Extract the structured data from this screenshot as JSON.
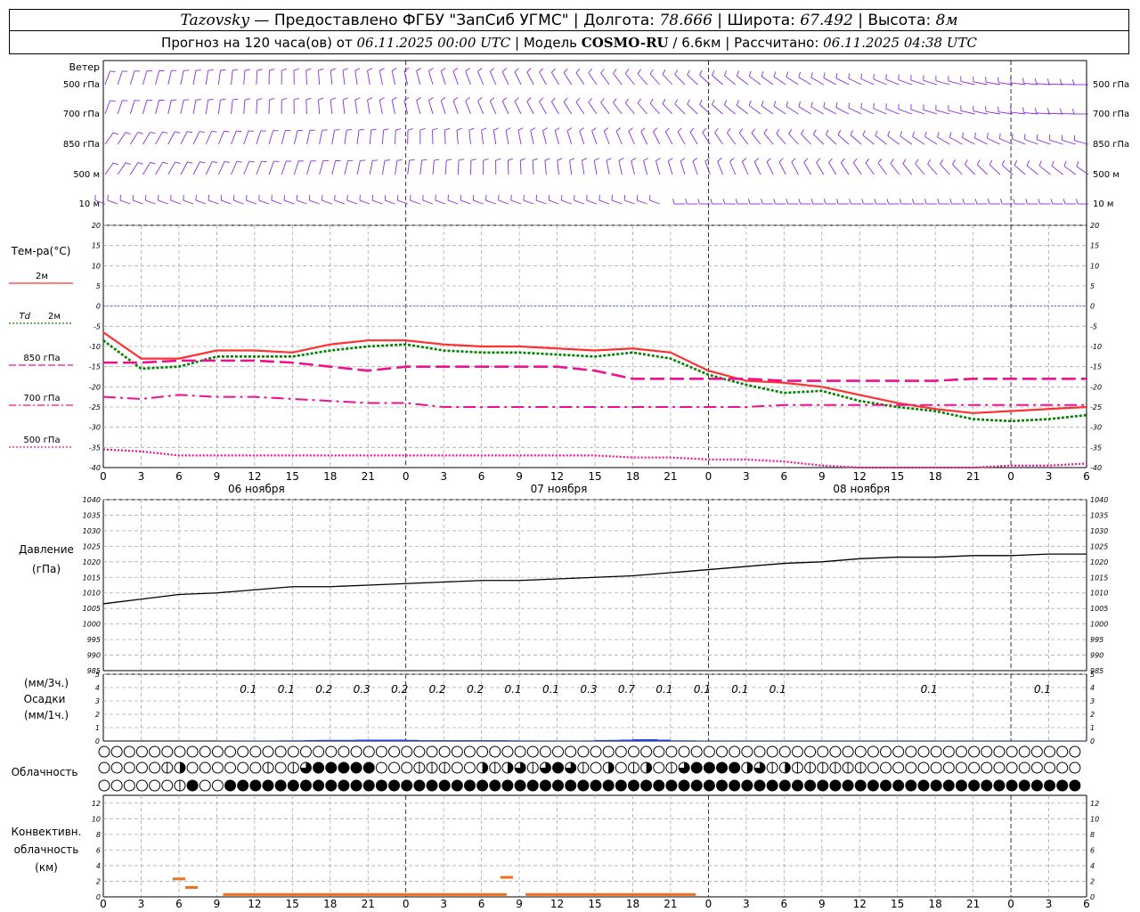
{
  "header": {
    "station": "Tazovsky",
    "provided_by": "— Предоставлено ФГБУ \"ЗапСиб УГМС\"",
    "lon_label": "Долгота:",
    "lon_value": "78.666",
    "lat_label": "Широта:",
    "lat_value": "67.492",
    "alt_label": "Высота:",
    "alt_value": "8м",
    "forecast_label": "Прогноз на 120 часа(ов) от",
    "forecast_start": "06.11.2025 00:00 UTC",
    "model_label": "Модель",
    "model_name": "COSMO-RU",
    "model_res": "/ 6.6км",
    "computed_label": "Рассчитано:",
    "computed_time": "06.11.2025 04:38 UTC"
  },
  "wind_panel": {
    "title": "Ветер",
    "levels": [
      "500 гПа",
      "700 гПа",
      "850 гПа",
      "500 м",
      "10 м"
    ],
    "color": "#8a2be2"
  },
  "time_axis": {
    "hour_ticks": [
      "0",
      "3",
      "6",
      "9",
      "12",
      "15",
      "18",
      "21",
      "0",
      "3",
      "6",
      "9",
      "12",
      "15",
      "18",
      "21",
      "0",
      "3",
      "6",
      "9",
      "12",
      "15",
      "18",
      "21",
      "0",
      "3",
      "6"
    ],
    "dates": [
      "06 ноября",
      "07 ноября",
      "08 ноября"
    ]
  },
  "chart_data": [
    {
      "type": "line",
      "name": "temperature",
      "title": "Тем-ра(°C)",
      "ylim": [
        -40,
        20
      ],
      "yticks": [
        "20",
        "15",
        "10",
        "5",
        "0",
        "-5",
        "-10",
        "-15",
        "-20",
        "-25",
        "-30",
        "-35",
        "-40"
      ],
      "x_hours": [
        0,
        3,
        6,
        9,
        12,
        15,
        18,
        21,
        24,
        27,
        30,
        33,
        36,
        39,
        42,
        45,
        48,
        51,
        54,
        57,
        60,
        63,
        66,
        69,
        72,
        75,
        78
      ],
      "series": [
        {
          "name": "2м",
          "color": "#ff3030",
          "values": [
            -6.5,
            -13,
            -13,
            -11,
            -11,
            -11.5,
            -9.5,
            -8.5,
            -8.5,
            -9.5,
            -10,
            -10,
            -10.5,
            -11,
            -10.5,
            -11.5,
            -16,
            -18.5,
            -19,
            -20,
            -22,
            -24,
            -25.5,
            -26.5,
            -26,
            -25.5,
            -25
          ]
        },
        {
          "name": "Td 2м",
          "color": "#008000",
          "values": [
            -8.5,
            -15.5,
            -15,
            -12.5,
            -12.5,
            -12.5,
            -11,
            -10,
            -9.5,
            -11,
            -11.5,
            -11.5,
            -12,
            -12.5,
            -11.5,
            -13,
            -17,
            -19.5,
            -21.5,
            -21,
            -23.5,
            -25,
            -26,
            -28,
            -28.5,
            -28,
            -27
          ]
        },
        {
          "name": "850 гПа",
          "color": "#ee1090",
          "values": [
            -14,
            -14,
            -13.5,
            -13.5,
            -13.5,
            -14,
            -15,
            -16,
            -15,
            -15,
            -15,
            -15,
            -15,
            -16,
            -18,
            -18,
            -18,
            -18,
            -18.5,
            -18.5,
            -18.5,
            -18.5,
            -18.5,
            -18,
            -18,
            -18,
            -18
          ]
        },
        {
          "name": "700 гПа",
          "color": "#ee1090",
          "values": [
            -22.5,
            -23,
            -22,
            -22.5,
            -22.5,
            -23,
            -23.5,
            -24,
            -24,
            -25,
            -25,
            -25,
            -25,
            -25,
            -25,
            -25,
            -25,
            -25,
            -24.5,
            -24.5,
            -24.5,
            -24.5,
            -24.5,
            -24.5,
            -24.5,
            -24.5,
            -24.5
          ]
        },
        {
          "name": "500 гПа",
          "color": "#ee1090",
          "values": [
            -35.5,
            -36,
            -37,
            -37,
            -37,
            -37,
            -37,
            -37,
            -37,
            -37,
            -37,
            -37,
            -37,
            -37,
            -37.5,
            -37.5,
            -38,
            -38,
            -38.5,
            -39.5,
            -40,
            -40,
            -40,
            -40,
            -39.5,
            -39.5,
            -39
          ]
        }
      ]
    },
    {
      "type": "line",
      "name": "pressure",
      "title": "Давление",
      "ylabel": "(гПа)",
      "ylim": [
        985,
        1040
      ],
      "yticks": [
        "1040",
        "1035",
        "1030",
        "1025",
        "1020",
        "1015",
        "1010",
        "1005",
        "1000",
        "995",
        "990",
        "985"
      ],
      "x_hours": [
        0,
        3,
        6,
        9,
        12,
        15,
        18,
        21,
        24,
        27,
        30,
        33,
        36,
        39,
        42,
        45,
        48,
        51,
        54,
        57,
        60,
        63,
        66,
        69,
        72,
        75,
        78
      ],
      "values": [
        1006.5,
        1008,
        1009.5,
        1010,
        1011,
        1012,
        1012,
        1012.5,
        1013,
        1013.5,
        1014,
        1014,
        1014.5,
        1015,
        1015.5,
        1016.5,
        1017.5,
        1018.5,
        1019.5,
        1020,
        1021,
        1021.5,
        1021.5,
        1022,
        1022,
        1022.5,
        1022.5
      ]
    },
    {
      "type": "bar",
      "name": "precipitation",
      "title": "Осадки",
      "ylabel_top": "(мм/3ч.)",
      "ylabel_bottom": "(мм/1ч.)",
      "ylim": [
        0,
        5
      ],
      "yticks": [
        "5",
        "4",
        "3",
        "2",
        "1",
        "0"
      ],
      "labels": [
        {
          "hour": 12,
          "text": "0.1"
        },
        {
          "hour": 15,
          "text": "0.1"
        },
        {
          "hour": 18,
          "text": "0.2"
        },
        {
          "hour": 21,
          "text": "0.3"
        },
        {
          "hour": 24,
          "text": "0.2"
        },
        {
          "hour": 27,
          "text": "0.2"
        },
        {
          "hour": 30,
          "text": "0.2"
        },
        {
          "hour": 33,
          "text": "0.1"
        },
        {
          "hour": 36,
          "text": "0.1"
        },
        {
          "hour": 39,
          "text": "0.3"
        },
        {
          "hour": 42,
          "text": "0.7"
        },
        {
          "hour": 45,
          "text": "0.1"
        },
        {
          "hour": 48,
          "text": "0.1"
        },
        {
          "hour": 51,
          "text": "0.1"
        },
        {
          "hour": 54,
          "text": "0.1"
        },
        {
          "hour": 66,
          "text": "0.1"
        },
        {
          "hour": 75,
          "text": "0.1"
        }
      ],
      "hourly_values": [
        0,
        0,
        0,
        0,
        0,
        0,
        0,
        0,
        0,
        0.02,
        0.02,
        0.03,
        0.03,
        0.03,
        0.05,
        0.05,
        0.07,
        0.08,
        0.08,
        0.08,
        0.1,
        0.1,
        0.1,
        0.1,
        0.08,
        0.06,
        0.06,
        0.06,
        0.06,
        0.06,
        0.06,
        0.06,
        0.05,
        0.04,
        0.02,
        0.02,
        0.02,
        0.03,
        0.04,
        0.07,
        0.08,
        0.1,
        0.13,
        0.13,
        0.1,
        0.05,
        0.05,
        0.03,
        0.02,
        0.02,
        0.02,
        0.02,
        0.02,
        0.02,
        0.02,
        0.02,
        0.02,
        0.02,
        0.02,
        0.02,
        0.02,
        0.02,
        0.02,
        0.02,
        0.02,
        0.02,
        0.03,
        0.02,
        0.02,
        0.02,
        0.02,
        0.02,
        0.02,
        0.02,
        0.03,
        0.02,
        0.02,
        0.02
      ],
      "color": "#2040e0"
    },
    {
      "type": "table",
      "name": "cloudiness",
      "title": "Облачность",
      "note": "Cloud cover symbols in oktas for three layers (top: high, middle: medium, bottom: low), one per hour",
      "high": [
        0,
        0,
        0,
        0,
        0,
        0,
        0,
        0,
        0,
        0,
        0,
        0,
        0,
        0,
        0,
        0,
        0,
        0,
        0,
        0,
        0,
        0,
        0,
        0,
        0,
        0,
        0,
        0,
        0,
        0,
        0,
        0,
        0,
        0,
        0,
        0,
        0,
        0,
        0,
        0,
        0,
        0,
        0,
        0,
        0,
        0,
        0,
        0,
        0,
        0,
        0,
        0,
        0,
        0,
        0,
        0,
        0,
        0,
        0,
        0,
        0,
        0,
        0,
        0,
        0,
        0,
        0,
        0,
        0,
        0,
        0,
        0,
        0,
        0,
        0,
        0,
        0,
        0
      ],
      "middle": [
        0,
        0,
        0,
        0,
        0,
        2,
        4,
        0,
        0,
        0,
        0,
        0,
        0,
        2,
        0,
        2,
        6,
        8,
        8,
        8,
        8,
        8,
        0,
        0,
        0,
        2,
        2,
        2,
        0,
        0,
        4,
        2,
        4,
        6,
        2,
        6,
        8,
        6,
        2,
        0,
        4,
        0,
        2,
        4,
        0,
        2,
        6,
        8,
        8,
        8,
        8,
        4,
        6,
        2,
        4,
        2,
        2,
        2,
        2,
        2,
        2,
        0,
        0,
        0,
        0,
        0,
        0,
        0,
        0,
        0,
        0,
        0,
        0,
        0,
        0,
        0,
        0,
        0
      ],
      "low": [
        0,
        0,
        0,
        0,
        0,
        0,
        2,
        8,
        0,
        0,
        8,
        8,
        8,
        8,
        8,
        8,
        8,
        8,
        8,
        8,
        8,
        8,
        8,
        8,
        8,
        8,
        8,
        8,
        8,
        8,
        8,
        8,
        8,
        8,
        8,
        8,
        8,
        8,
        8,
        8,
        8,
        8,
        8,
        8,
        8,
        8,
        8,
        8,
        8,
        8,
        8,
        8,
        8,
        8,
        8,
        8,
        8,
        8,
        8,
        8,
        8,
        8,
        8,
        8,
        8,
        8,
        8,
        8,
        8,
        8,
        8,
        8,
        8,
        8,
        8,
        8,
        8,
        8
      ]
    },
    {
      "type": "bar",
      "name": "convective_cloudiness",
      "title": "Конвективн.",
      "title2": "облачность",
      "ylabel": "(км)",
      "ylim": [
        0,
        13
      ],
      "yticks": [
        "12",
        "10",
        "8",
        "6",
        "4",
        "2",
        "0"
      ],
      "color": "#f07020",
      "segments": [
        {
          "start_hour": 5.5,
          "end_hour": 6.5,
          "value": 2.3
        },
        {
          "start_hour": 6.5,
          "end_hour": 7.5,
          "value": 1.2
        },
        {
          "start_hour": 9.5,
          "end_hour": 32,
          "value": 0.3
        },
        {
          "start_hour": 31.5,
          "end_hour": 32.5,
          "value": 2.5
        },
        {
          "start_hour": 33.5,
          "end_hour": 47,
          "value": 0.3
        }
      ]
    }
  ]
}
